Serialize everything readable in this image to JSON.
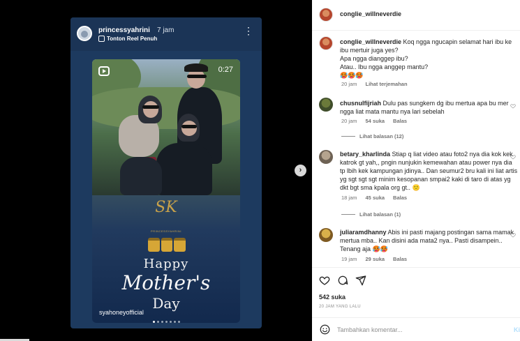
{
  "story": {
    "username": "princessyahrini",
    "time": "7 jam",
    "reel_link": "Tonton Reel Penuh",
    "more_icon": "ellipsis-vertical-icon",
    "duration": "0:27",
    "logo_text": "SK",
    "logo_caption": "PRINCESSYAHRINI",
    "greeting_line1": "Happy",
    "greeting_line2": "Mother's",
    "greeting_line3": "Day",
    "watermark": "syahoneyofficial"
  },
  "pane": {
    "header_username": "conglie_willneverdie"
  },
  "comments": [
    {
      "user": "conglie_willneverdie",
      "text": "Koq ngga ngucapin selamat hari ibu ke ibu mertuir juga yes?\nApa ngga dianggep ibu?\nAtau.. Ibu ngga anggep mantu?\n🥵🥵🥵",
      "time": "20 jam",
      "likes": "",
      "action": "Lihat terjemahan"
    },
    {
      "user": "chusnulfijriah",
      "text": "Dulu pas sungkem dg ibu mertua apa bu mer ngga liat mata mantu nya lari sebelah",
      "time": "20 jam",
      "likes": "54 suka",
      "action": "Balas",
      "replies": "Lihat balasan (12)"
    },
    {
      "user": "betary_kharlinda",
      "text": "Stiap q liat video atau foto2 nya dia kok kek katrok gt yah,, pngin nunjukin kemewahan atau power nya dia tp lbih kek kampungan jdinya.. Dan seumur2 bru kali ini liat artis yg sgt sgt sgt minim kesopanan smpai2 kaki di taro di atas yg dkt bgt sma kpala org gt.. 🙁",
      "time": "18 jam",
      "likes": "45 suka",
      "action": "Balas",
      "replies": "Lihat balasan (1)"
    },
    {
      "user": "juliaramdhanny",
      "text": "Abis ini pasti majang postingan sama mamak mertua mba.. Kan disini ada mata2 nya.. Pasti disampein.. Tenang aja 🥵🥵",
      "time": "19 jam",
      "likes": "29 suka",
      "action": "Balas"
    }
  ],
  "actions": {
    "likes": "542 suka",
    "ago": "20 JAM YANG LALU"
  },
  "add_comment": {
    "placeholder": "Tambahkan komentar...",
    "post_label": "Ki"
  },
  "colors": {
    "story_bg": "#1d3a5f",
    "link_blue": "#b2dffc",
    "text": "#262626",
    "muted": "#737373"
  }
}
